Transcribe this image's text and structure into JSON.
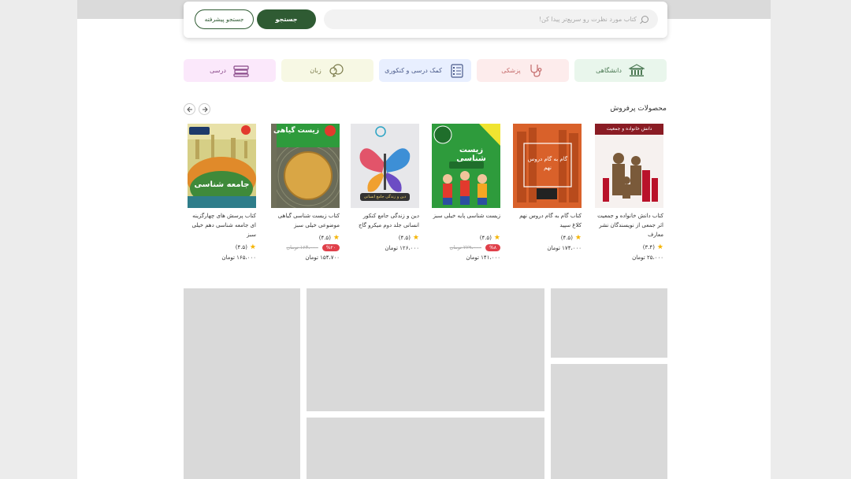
{
  "search": {
    "placeholder": "کتاب مورد نظرت رو سریع‌تر پیدا کن!",
    "search_button": "جستجو",
    "advanced_button": "جستجو پیشرفته"
  },
  "categories": [
    {
      "label": "دانشگاهی",
      "icon": "university-icon",
      "bg": "#e9f6ec",
      "color": "#4d7a55"
    },
    {
      "label": "پزشکی",
      "icon": "stethoscope-icon",
      "bg": "#fdecec",
      "color": "#c46a6a"
    },
    {
      "label": "کمک درسی و کنکوری",
      "icon": "checklist-icon",
      "bg": "#e8efff",
      "color": "#4a5a8a"
    },
    {
      "label": "زبان",
      "icon": "language-icon",
      "bg": "#f7f8e4",
      "color": "#7a7a4a"
    },
    {
      "label": "درسی",
      "icon": "books-icon",
      "bg": "#fbe8fb",
      "color": "#8a4a8a"
    }
  ],
  "bestsellers": {
    "title": "محصولات پرفروش",
    "products": [
      {
        "name": "کتاب دانش خانواده و جمعیت اثر جمعی از نویسندگان نشر معارف",
        "rating": "(۳.۴)",
        "discount": "",
        "old_price": "",
        "price": "۲۵،۰۰۰ تومان",
        "cover_title": "دانش خانواده و جمعیت"
      },
      {
        "name": "کتاب گام به گام دروس نهم کلاغ سپید",
        "rating": "(۴.۵)",
        "discount": "",
        "old_price": "",
        "price": "۱۷۴،۰۰۰ تومان",
        "cover_title": "گام به گام دروس نهم"
      },
      {
        "name": "زیست شناسی پایه خیلی سبز",
        "rating": "(۴.۵)",
        "discount": "%۸",
        "old_price": "۲۲۹،۰۰۰ تومان",
        "price": "۱۴۱،۰۰۰ تومان",
        "cover_title": "زیست شناسی"
      },
      {
        "name": "دین و زندگی جامع کنکور انسانی جلد دوم میکرو گاج",
        "rating": "(۴.۵)",
        "discount": "",
        "old_price": "",
        "price": "۱۲۶،۰۰۰ تومان",
        "cover_title": "دین و زندگی جامع انسانی"
      },
      {
        "name": "کتاب زیست شناسی گیاهی موضوعی خیلی سبز",
        "rating": "(۴.۵)",
        "discount": "%۲۰",
        "old_price": "۱۶۳،۰۰۰ تومان",
        "price": "۱۵۴،۷۰۰ تومان",
        "cover_title": "زیست گیاهی"
      },
      {
        "name": "کتاب پرسش های چهارگزینه ای جامعه شناسی دهم خیلی سبز",
        "rating": "(۴.۵)",
        "discount": "",
        "old_price": "",
        "price": "۱۶۵،۰۰۰ تومان",
        "cover_title": "جامعه شناسی"
      }
    ]
  }
}
